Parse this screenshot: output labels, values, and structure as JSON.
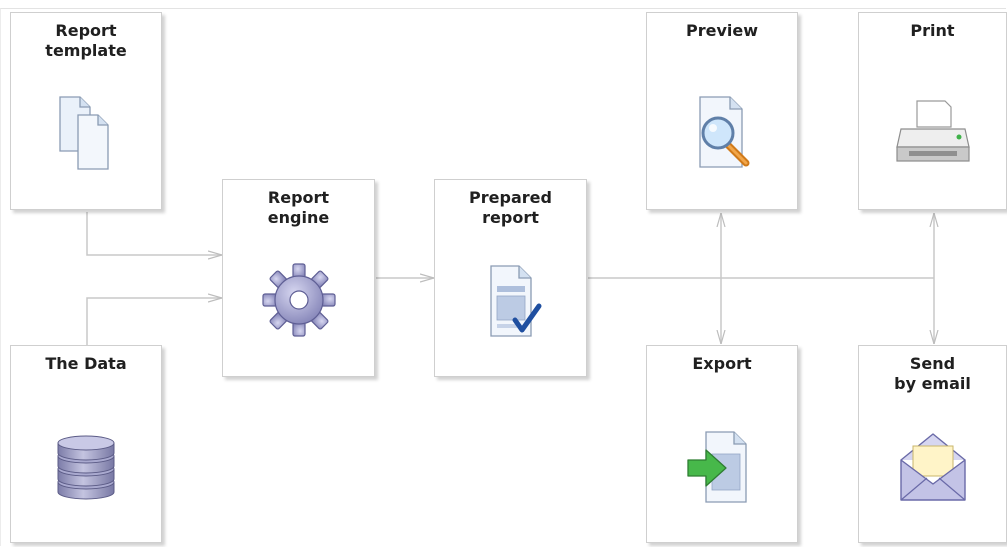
{
  "diagram": {
    "nodes": {
      "report_template": {
        "label": "Report\ntemplate",
        "icon": "documents-icon"
      },
      "the_data": {
        "label": "The Data",
        "icon": "database-icon"
      },
      "report_engine": {
        "label": "Report\nengine",
        "icon": "gear-icon"
      },
      "prepared_report": {
        "label": "Prepared\nreport",
        "icon": "checked-document-icon"
      },
      "preview": {
        "label": "Preview",
        "icon": "magnifier-document-icon"
      },
      "print": {
        "label": "Print",
        "icon": "printer-icon"
      },
      "export": {
        "label": "Export",
        "icon": "export-document-icon"
      },
      "send_by_email": {
        "label": "Send\nby email",
        "icon": "envelope-icon"
      }
    },
    "edges": [
      {
        "from": "report_template",
        "to": "report_engine"
      },
      {
        "from": "the_data",
        "to": "report_engine"
      },
      {
        "from": "report_engine",
        "to": "prepared_report"
      },
      {
        "from": "prepared_report",
        "to": "preview"
      },
      {
        "from": "prepared_report",
        "to": "export"
      },
      {
        "from": "prepared_report",
        "to": "print"
      },
      {
        "from": "prepared_report",
        "to": "send_by_email"
      }
    ],
    "colors": {
      "connector": "#c8c8c8",
      "node_border": "#cfcfcf",
      "label": "#202020"
    }
  }
}
